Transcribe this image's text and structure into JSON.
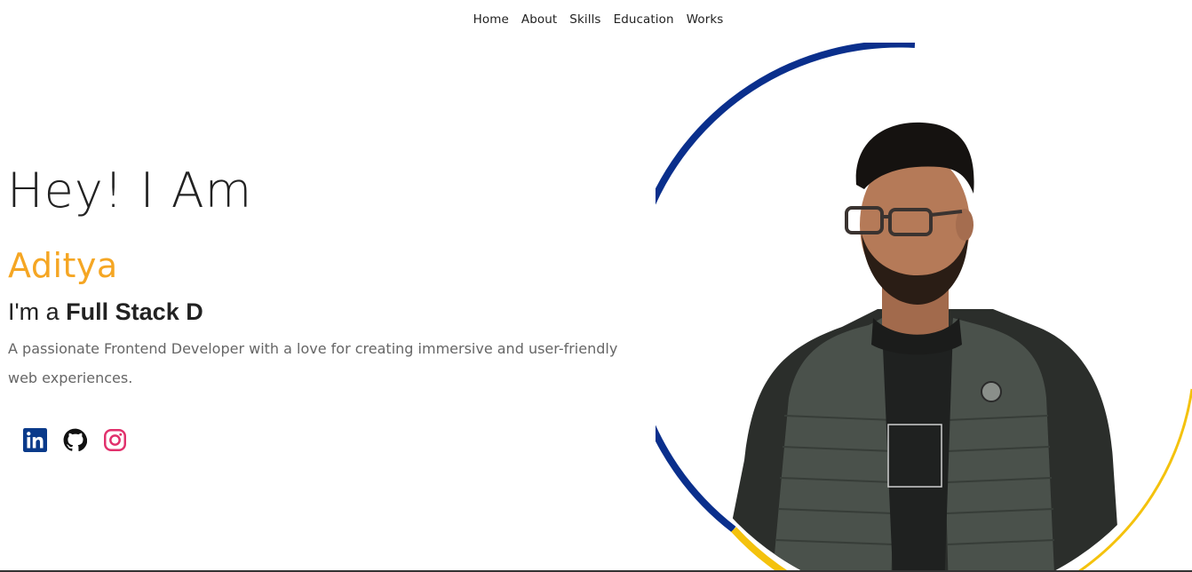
{
  "nav": {
    "items": [
      "Home",
      "About",
      "Skills",
      "Education",
      "Works"
    ]
  },
  "hero": {
    "greeting": "Hey! I Am",
    "name": "Aditya",
    "role_prefix": "I'm a ",
    "role_typed": "Full Stack D",
    "description": "A passionate Frontend Developer with a love for creating immersive and user-friendly web experiences."
  },
  "socials": [
    {
      "icon": "linkedin-icon",
      "color": "#0a3a8a"
    },
    {
      "icon": "github-icon",
      "color": "#111111"
    },
    {
      "icon": "instagram-icon",
      "color": "#e1306c"
    }
  ],
  "colors": {
    "accent": "#f5a623",
    "ring_blue": "#0a2f8c",
    "ring_yellow": "#f4c20d",
    "text": "#222222",
    "muted": "#666666"
  }
}
